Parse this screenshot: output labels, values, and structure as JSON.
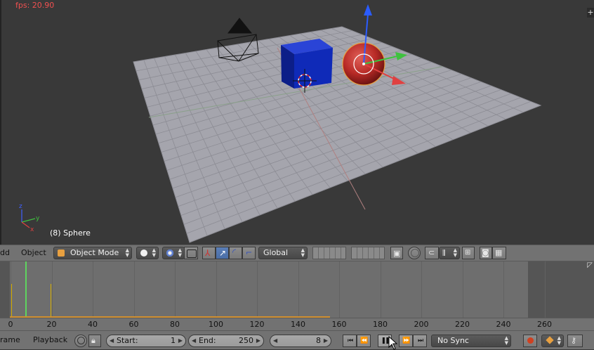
{
  "viewport": {
    "fps": "fps: 20.90",
    "object_info": "(8) Sphere",
    "corner_glyph": "+",
    "axis_labels": {
      "x": "x",
      "y": "y",
      "z": "z"
    }
  },
  "view_header": {
    "menu_add": "dd",
    "menu_object": "Object",
    "mode": "Object Mode",
    "orientation": "Global"
  },
  "timeline": {
    "current_frame": 8,
    "ruler_ticks": [
      "0",
      "20",
      "40",
      "60",
      "80",
      "100",
      "120",
      "140",
      "160",
      "180",
      "200",
      "220",
      "240",
      "260"
    ]
  },
  "timeline_header": {
    "menu_frame": "rame",
    "menu_playback": "Playback",
    "start_label": "Start:",
    "start_value": "1",
    "end_label": "End:",
    "end_value": "250",
    "frame_value": "8",
    "sync": "No Sync"
  },
  "colors": {
    "cube": "#0f2ab8",
    "sphere": "#c0302a",
    "floor": "#a5a5ad",
    "current_frame": "#5fd45f",
    "fps_text": "#f05050"
  }
}
